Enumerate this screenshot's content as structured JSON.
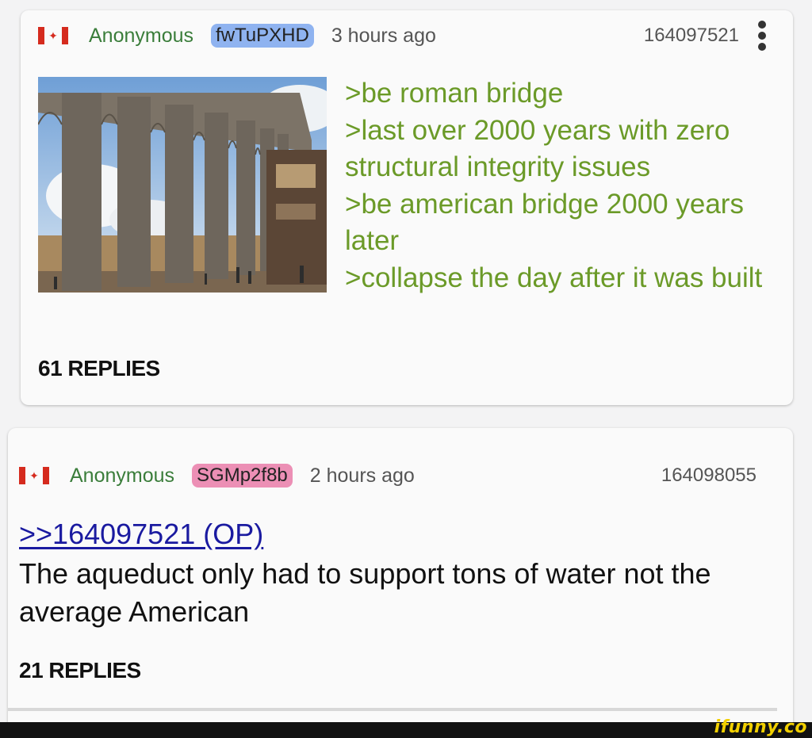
{
  "op": {
    "flag": "canada-flag",
    "author": "Anonymous",
    "poster_id": "fwTuPXHD",
    "timestamp": "3 hours ago",
    "post_number": "164097521",
    "greentext": [
      ">be roman bridge",
      ">last over 2000 years with zero structural integrity issues",
      ">be american bridge 2000 years later",
      ">collapse the day after it was built"
    ],
    "replies": "61 REPLIES",
    "image": "aqueduct-photo"
  },
  "reply": {
    "flag": "canada-flag",
    "author": "Anonymous",
    "poster_id": "SGMp2f8b",
    "timestamp": "2 hours ago",
    "post_number": "164098055",
    "quote_link": ">>164097521 (OP)",
    "comment": "The aqueduct only had to support tons of water not the average American",
    "replies": "21 REPLIES"
  },
  "watermark": "ifunny.co",
  "colors": {
    "greentext": "#6b9a28",
    "author": "#3a7d3a",
    "badge_op": "#8fb3f0",
    "badge_reply": "#ec8fb5",
    "link": "#1a1aa0"
  }
}
